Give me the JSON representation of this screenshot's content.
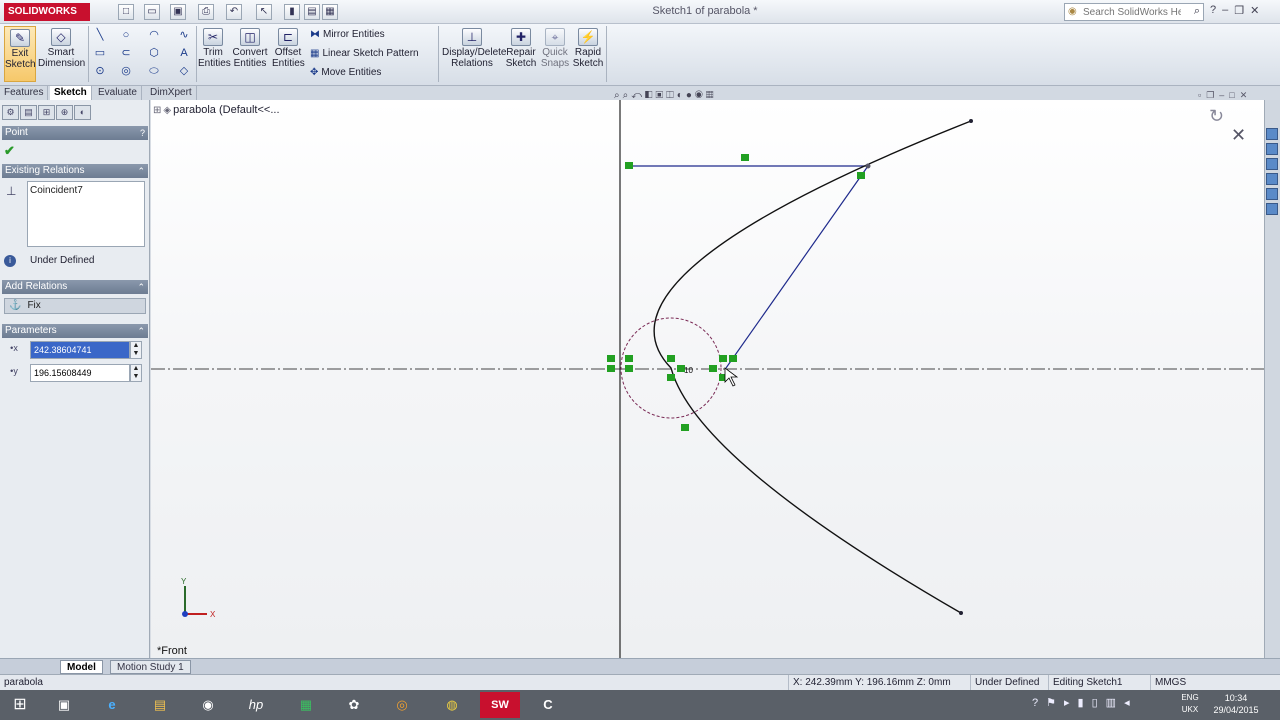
{
  "app": {
    "logo_text": "SOLIDWORKS",
    "document_title": "Sketch1 of parabola *",
    "help_search_placeholder": "Search SolidWorks Help"
  },
  "ribbon": {
    "exit_sketch": "Exit Sketch",
    "smart_dimension": "Smart Dimension",
    "trim_entities": "Trim Entities",
    "convert_entities": "Convert Entities",
    "offset_entities": "Offset Entities",
    "mirror_entities": "Mirror Entities",
    "linear_sketch_pattern": "Linear Sketch Pattern",
    "move_entities": "Move Entities",
    "display_delete_relations": "Display/Delete Relations",
    "repair_sketch": "Repair Sketch",
    "quick_snaps": "Quick Snaps",
    "rapid_sketch": "Rapid Sketch"
  },
  "command_tabs": [
    "Features",
    "Sketch",
    "Evaluate",
    "DimXpert"
  ],
  "active_command_tab": "Sketch",
  "property_manager": {
    "title": "Point",
    "existing_relations_header": "Existing Relations",
    "relations": [
      "Coincident7"
    ],
    "status": "Under Defined",
    "add_relations_header": "Add Relations",
    "add_relations_option": "Fix",
    "parameters_header": "Parameters",
    "x_value": "242.38604741",
    "y_value": "196.15608449"
  },
  "graphics": {
    "feature_tree_item": "parabola  (Default<<...",
    "view_label": "*Front",
    "dimension_label": "10",
    "axis_x_label": "X",
    "axis_y_label": "Y"
  },
  "model_tabs": [
    "Model",
    "Motion Study 1"
  ],
  "active_model_tab": "Model",
  "statusbar": {
    "part_name": "parabola",
    "coordinates": "X: 242.39mm Y: 196.16mm Z: 0mm",
    "definition": "Under Defined",
    "editing": "Editing Sketch1",
    "units": "MMGS"
  },
  "taskbar": {
    "language_top": "ENG",
    "language_bottom": "UKX",
    "time": "10:34",
    "date": "29/04/2015"
  },
  "colors": {
    "sketch_line": "#1a1a1a",
    "construction_line": "#1e2a8c",
    "circle": "#7a2a55",
    "relation_marker": "#22a022",
    "selection": "#3a67c8"
  }
}
